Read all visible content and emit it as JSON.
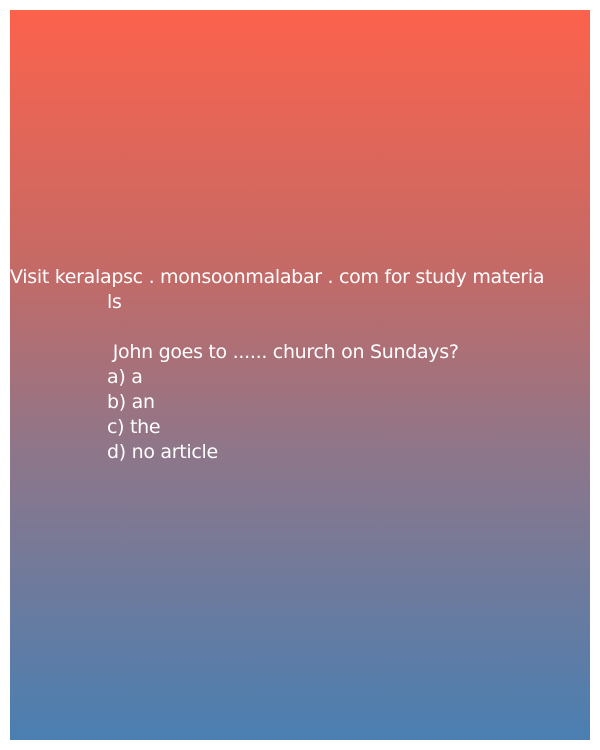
{
  "card": {
    "promo_line_1": "Visit keralapsc . monsoonmalabar . com for study materia",
    "promo_line_2": "ls",
    "question": " John goes to ...... church on Sundays?",
    "options": [
      "a) a",
      "b) an",
      "c) the",
      "d) no article"
    ]
  },
  "colors": {
    "gradient_top": "#fc624c",
    "gradient_bottom": "#4a7fb2",
    "text": "#ffffff"
  }
}
